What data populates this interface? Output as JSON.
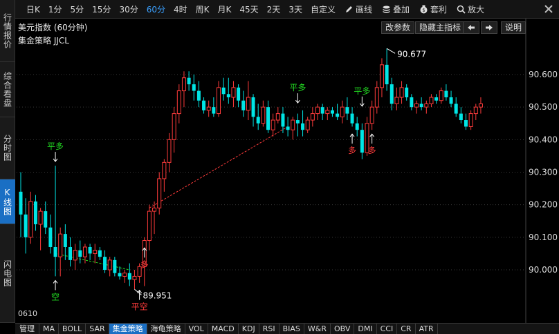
{
  "left_tabs": [
    {
      "label": "行情报价",
      "name": "quote"
    },
    {
      "label": "综合看盘",
      "name": "overview"
    },
    {
      "label": "分时图",
      "name": "intraday"
    },
    {
      "label": "K线图",
      "name": "kline"
    },
    {
      "label": "闪电图",
      "name": "flash"
    }
  ],
  "toolbar": {
    "periods": [
      "日K",
      "1分",
      "5分",
      "15分",
      "30分",
      "60分",
      "4时",
      "周K",
      "月K",
      "45天",
      "2天",
      "3天",
      "自定义"
    ],
    "active_period": "60分",
    "tools": [
      {
        "label": "画线",
        "icon": "pencil-icon"
      },
      {
        "label": "叠加",
        "icon": "stack-icon"
      },
      {
        "label": "套利",
        "icon": "arbitrage-icon"
      },
      {
        "label": "放大",
        "icon": "zoom-icon"
      }
    ]
  },
  "chart_header": {
    "title": "美元指数 (60分钟)",
    "strategy": "集金策略 JJCL",
    "buttons": [
      "改参数",
      "隐藏主指标",
      "说明"
    ]
  },
  "period_label": "0610",
  "bottom_tabs": [
    "管理",
    "MA",
    "BOLL",
    "SAR",
    "集金策略",
    "海龟策略",
    "VOL",
    "MACD",
    "KDJ",
    "RSI",
    "BIAS",
    "W&R",
    "OBV",
    "DMI",
    "CCI",
    "CR",
    "ATR"
  ],
  "active_bottom_tab": "集金策略",
  "colors": {
    "up": "#ff3b3b",
    "down": "#00e5e5",
    "signal_green": "#22dd22",
    "signal_red": "#ff3b3b",
    "active_tab": "#1a6fc4"
  },
  "chart_data": {
    "type": "candlestick",
    "ylim": [
      89.95,
      90.67
    ],
    "y_ticks": [
      "90.600",
      "90.500",
      "90.400",
      "90.300",
      "90.200",
      "90.100",
      "90.000"
    ],
    "y_tick_values": [
      90.6,
      90.5,
      90.4,
      90.3,
      90.2,
      90.1,
      90.0
    ],
    "high_label": "90.677",
    "low_label": "89.951",
    "candles": [
      [
        90.24,
        90.3,
        90.1,
        90.17
      ],
      [
        90.17,
        90.22,
        90.05,
        90.1
      ],
      [
        90.1,
        90.24,
        90.08,
        90.21
      ],
      [
        90.21,
        90.23,
        90.12,
        90.14
      ],
      [
        90.14,
        90.19,
        90.06,
        90.18
      ],
      [
        90.18,
        90.21,
        90.11,
        90.13
      ],
      [
        90.13,
        90.17,
        90.05,
        90.07
      ],
      [
        90.07,
        90.32,
        89.98,
        90.04
      ],
      [
        90.04,
        90.13,
        89.98,
        90.11
      ],
      [
        90.11,
        90.14,
        90.03,
        90.07
      ],
      [
        90.07,
        90.1,
        90.01,
        90.03
      ],
      [
        90.03,
        90.08,
        90.0,
        90.06
      ],
      [
        90.06,
        90.09,
        90.02,
        90.04
      ],
      [
        90.04,
        90.08,
        90.02,
        90.07
      ],
      [
        90.07,
        90.08,
        90.03,
        90.05
      ],
      [
        90.05,
        90.08,
        90.02,
        90.06
      ],
      [
        90.06,
        90.07,
        90.03,
        90.04
      ],
      [
        90.04,
        90.06,
        89.99,
        90.0
      ],
      [
        90.0,
        90.04,
        89.98,
        90.03
      ],
      [
        90.03,
        90.04,
        89.98,
        89.99
      ],
      [
        89.99,
        90.01,
        89.97,
        89.98
      ],
      [
        89.98,
        90.0,
        89.96,
        89.99
      ],
      [
        89.99,
        90.02,
        89.95,
        89.97
      ],
      [
        89.97,
        90.0,
        89.94,
        89.98
      ],
      [
        89.98,
        90.02,
        89.96,
        90.01
      ],
      [
        90.01,
        90.1,
        89.95,
        90.09
      ],
      [
        90.09,
        90.2,
        90.06,
        90.18
      ],
      [
        90.18,
        90.21,
        90.11,
        90.19
      ],
      [
        90.19,
        90.3,
        90.17,
        90.28
      ],
      [
        90.28,
        90.34,
        90.24,
        90.33
      ],
      [
        90.33,
        90.42,
        90.3,
        90.4
      ],
      [
        90.4,
        90.5,
        90.36,
        90.48
      ],
      [
        90.48,
        90.57,
        90.45,
        90.55
      ],
      [
        90.55,
        90.61,
        90.5,
        90.59
      ],
      [
        90.59,
        90.61,
        90.55,
        90.57
      ],
      [
        90.57,
        90.6,
        90.52,
        90.55
      ],
      [
        90.55,
        90.58,
        90.5,
        90.52
      ],
      [
        90.52,
        90.53,
        90.48,
        90.49
      ],
      [
        90.49,
        90.52,
        90.47,
        90.5
      ],
      [
        90.5,
        90.53,
        90.47,
        90.48
      ],
      [
        90.48,
        90.58,
        90.47,
        90.56
      ],
      [
        90.56,
        90.59,
        90.52,
        90.54
      ],
      [
        90.54,
        90.59,
        90.51,
        90.53
      ],
      [
        90.53,
        90.58,
        90.5,
        90.56
      ],
      [
        90.56,
        90.57,
        90.5,
        90.52
      ],
      [
        90.52,
        90.55,
        90.47,
        90.49
      ],
      [
        90.49,
        90.58,
        90.46,
        90.53
      ],
      [
        90.53,
        90.54,
        90.44,
        90.47
      ],
      [
        90.47,
        90.51,
        90.43,
        90.45
      ],
      [
        90.45,
        90.52,
        90.44,
        90.5
      ],
      [
        90.5,
        90.52,
        90.42,
        90.43
      ],
      [
        90.43,
        90.48,
        90.41,
        90.46
      ],
      [
        90.46,
        90.5,
        90.45,
        90.48
      ],
      [
        90.48,
        90.5,
        90.42,
        90.44
      ],
      [
        90.44,
        90.47,
        90.41,
        90.43
      ],
      [
        90.43,
        90.47,
        90.4,
        90.46
      ],
      [
        90.46,
        90.48,
        90.41,
        90.45
      ],
      [
        90.45,
        90.49,
        90.41,
        90.43
      ],
      [
        90.43,
        90.47,
        90.42,
        90.46
      ],
      [
        90.46,
        90.5,
        90.44,
        90.48
      ],
      [
        90.48,
        90.51,
        90.46,
        90.5
      ],
      [
        90.5,
        90.51,
        90.46,
        90.48
      ],
      [
        90.48,
        90.5,
        90.46,
        90.49
      ],
      [
        90.49,
        90.5,
        90.47,
        90.48
      ],
      [
        90.48,
        90.51,
        90.46,
        90.47
      ],
      [
        90.47,
        90.52,
        90.45,
        90.5
      ],
      [
        90.5,
        90.53,
        90.46,
        90.48
      ],
      [
        90.48,
        90.5,
        90.44,
        90.45
      ],
      [
        90.45,
        90.47,
        90.41,
        90.43
      ],
      [
        90.43,
        90.45,
        90.34,
        90.36
      ],
      [
        90.36,
        90.47,
        90.35,
        90.45
      ],
      [
        90.45,
        90.52,
        90.43,
        90.5
      ],
      [
        90.5,
        90.58,
        90.48,
        90.56
      ],
      [
        90.56,
        90.65,
        90.53,
        90.63
      ],
      [
        90.63,
        90.68,
        90.55,
        90.57
      ],
      [
        90.57,
        90.59,
        90.49,
        90.51
      ],
      [
        90.51,
        90.56,
        90.49,
        90.53
      ],
      [
        90.53,
        90.58,
        90.51,
        90.56
      ],
      [
        90.56,
        90.57,
        90.52,
        90.53
      ],
      [
        90.53,
        90.54,
        90.49,
        90.5
      ],
      [
        90.5,
        90.52,
        90.48,
        90.51
      ],
      [
        90.51,
        90.53,
        90.49,
        90.5
      ],
      [
        90.5,
        90.52,
        90.48,
        90.51
      ],
      [
        90.51,
        90.54,
        90.5,
        90.53
      ],
      [
        90.53,
        90.54,
        90.51,
        90.52
      ],
      [
        90.52,
        90.56,
        90.51,
        90.55
      ],
      [
        90.55,
        90.57,
        90.52,
        90.53
      ],
      [
        90.53,
        90.55,
        90.5,
        90.51
      ],
      [
        90.51,
        90.53,
        90.47,
        90.48
      ],
      [
        90.48,
        90.5,
        90.45,
        90.46
      ],
      [
        90.46,
        90.48,
        90.43,
        90.44
      ],
      [
        90.44,
        90.49,
        90.43,
        90.48
      ],
      [
        90.48,
        90.51,
        90.46,
        90.5
      ],
      [
        90.5,
        90.53,
        90.48,
        90.51
      ]
    ],
    "signals": [
      {
        "index": 7,
        "label": "平多",
        "color": "green",
        "position": "above",
        "value": 90.32
      },
      {
        "index": 7,
        "label": "空",
        "color": "green",
        "position": "below",
        "value": 89.98
      },
      {
        "index": 24,
        "label": "平空",
        "color": "red",
        "position": "below",
        "value": 89.95
      },
      {
        "index": 25,
        "label": "多",
        "color": "red",
        "position": "below",
        "value": 90.08
      },
      {
        "index": 56,
        "label": "平多",
        "color": "green",
        "position": "above",
        "value": 90.5
      },
      {
        "index": 67,
        "label": "多",
        "color": "red",
        "position": "below",
        "value": 90.43
      },
      {
        "index": 69,
        "label": "平多",
        "color": "green",
        "position": "above",
        "value": 90.49
      },
      {
        "index": 71,
        "label": "多",
        "color": "red",
        "position": "below",
        "value": 90.43
      }
    ],
    "trend_lines": [
      {
        "color": "green",
        "from": [
          7,
          90.05
        ],
        "to": [
          22,
          90.0
        ]
      },
      {
        "color": "red",
        "from": [
          26,
          90.19
        ],
        "to": [
          54,
          90.44
        ]
      }
    ]
  }
}
